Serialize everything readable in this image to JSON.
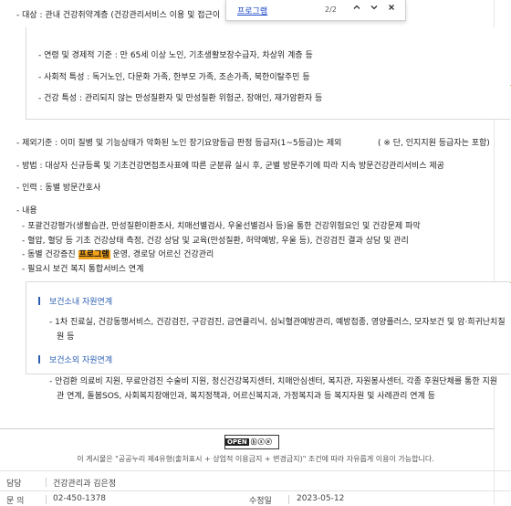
{
  "find_bar": {
    "query": "프로그램",
    "count": "2/2",
    "prev_icon": "chevron-up",
    "next_icon": "chevron-down",
    "close_icon": "close"
  },
  "content": {
    "target": "- 대상 : 관내 건강취약계층 (건강관리서비스 이용 및 접근이",
    "target_items": [
      "- 연령 및 경제적 기준 : 만 65세 이상 노인, 기초생활보장수급자, 차상위 계층 등",
      "- 사회적 특성 : 독거노인, 다문화 가족, 한부모 가족, 조손가족, 북한이탈주민 등",
      "- 건강 특성 : 관리되지 않는 만성질환자 및 만성질환 위험군, 장애인, 재가암환자 등"
    ],
    "exclusion": "- 제외기준 : 이미 질병 및 기능상태가 악화된 노인 장기요양등급 판정 등급자(1~5등급)는 제외",
    "exclusion_note": "( ※ 단, 인지지원 등급자는 포함)",
    "method": "- 방법 : 대상자 신규등록 및 기초건강면접조사표에 따른 군분류 실시 후, 군별 방문주기에 따라 지속 방문건강관리서비스 제공",
    "staff": "- 인력 : 동별 방문간호사",
    "content_title": "- 내용",
    "content_items": [
      "- 포괄건강평가(생활습관, 만성질환이환조사, 치매선별검사, 우울선별검사 등)을 통한 건강위험요인 및 건강문제 파악",
      "- 혈압, 혈당 등 기초 건강상태 측정, 건강 상담 및 교육(만성질환, 허약예방, 우울 등), 건강검진 결과 상담 및 관리"
    ],
    "content_item3_prefix": "- 동별 건강증진 ",
    "content_item3_highlight": "프로그램",
    "content_item3_suffix": " 운영, 경로당 어르신 건강관리",
    "content_item4": "- 필요시 보건 복지 통합서비스 연계"
  },
  "box": {
    "internal_title": "보건소내 자원연계",
    "internal_line1": "- 1차 진료실, 건강동행서비스, 건강검진, 구강검진, 금연클리닉, 심뇌혈관예방관리, 예방접종, 영양플러스, 모자보건 및 암·희귀난치질",
    "internal_line2": "원 등",
    "external_title": "보건소외 자원연계",
    "external_line1": "- 안검환 의료비 지원, 무료안검진 수술비 지원, 정신건강복지센터, 치매안심센터, 복지관, 자원봉사센터, 각종 후원단체를 통한 지원",
    "external_line2": "관 연계, 돌봄SOS, 사회복지장애인과, 복지정책과, 어르신복지과, 가정복지과 등 복지자원 및 사례관리 연계 등"
  },
  "license": {
    "open": "OPEN",
    "cc": "ⓑⓢⓔ",
    "notice": "이 게시물은 \"공공누리 제4유형(출처표시 + 상업적 이용금지 + 변경금지)\" 조건에 따라 자유롭게 이용이 가능합니다."
  },
  "footer": {
    "dept_label": "담당",
    "dept_value": "건강관리과 김은정",
    "phone_label": "문 의",
    "phone_value": "02-450-1378",
    "modified_label": "수정일",
    "modified_value": "2023-05-12"
  },
  "colors": {
    "accent_blue": "#2b5fb3",
    "highlight": "#f3a21b",
    "orange_tick": "#e7a33d"
  }
}
